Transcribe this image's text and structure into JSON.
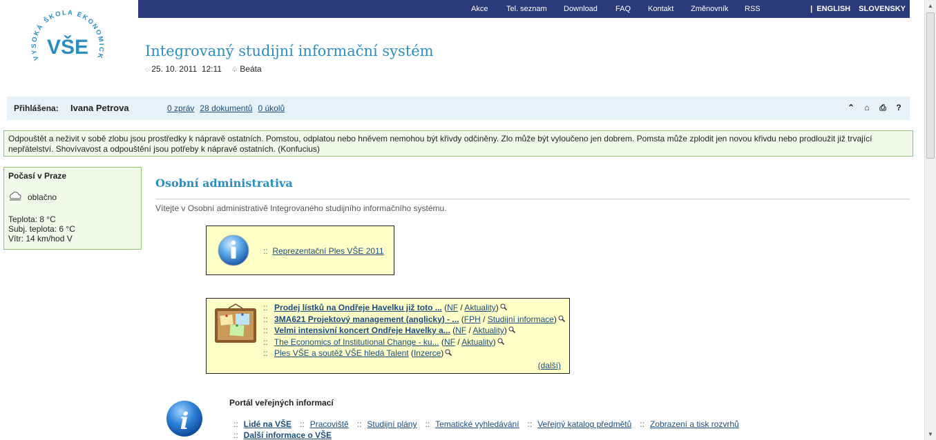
{
  "topnav": {
    "items": [
      "Akce",
      "Tel. seznam",
      "Download",
      "FAQ",
      "Kontakt",
      "Změnovník",
      "RSS"
    ],
    "separator": "|",
    "lang_en": "ENGLISH",
    "lang_sk": "SLOVENSKY"
  },
  "logo": {
    "text": "VŠE",
    "ring": "VYSOKÁ ŠKOLA EKONOMICKÁ V PRAZE"
  },
  "header": {
    "title": "Integrovaný studijní informační systém",
    "date": "25. 10. 2011",
    "time": "12:11",
    "nameday": "Beáta"
  },
  "loginbar": {
    "label": "Přihlášena:",
    "user": "Ivana Petrova",
    "messages_count": "0",
    "messages_label": "zpráv",
    "documents_count": "28",
    "documents_label": "dokumentů",
    "tasks_count": "0",
    "tasks_label": "úkolů"
  },
  "quote": "Odpouštět a neživit v sobě zlobu jsou prostředky k nápravě ostatních. Pomstou, odplatou nebo hněvem nemohou být křivdy odčiněny. Zlo může být vyloučeno jen dobrem. Pomsta může zplodit jen novou křivdu nebo prodloužit již trvající nepřátelství. Shovívavost a odpouštění jsou potřeby k nápravě ostatních. (Konfucius)",
  "weather": {
    "title": "Počasí v Praze",
    "condition": "oblačno",
    "temp": "Teplota: 8 °C",
    "feels": "Subj. teplota: 6 °C",
    "wind": "Vítr: 14 km/hod V"
  },
  "main": {
    "title": "Osobní administrativa",
    "welcome": "Vítejte v Osobní administrativě Integrovaného studijního informačního systému."
  },
  "info_box": {
    "sep": "::",
    "item": "Reprezentační Ples VŠE 2011"
  },
  "news_box": {
    "sep": "::",
    "items": [
      {
        "title": "Prodej lístků na Ondřeje Havelku již toto ...",
        "bold": true,
        "src": "NF",
        "cat": "Aktuality"
      },
      {
        "title": "3MA621 Projektový management (anglicky) - ...",
        "bold": true,
        "src": "FPH",
        "cat": "Studijní informace"
      },
      {
        "title": "Velmi intensivní koncert Ondřeje Havelky a...",
        "bold": true,
        "src": "NF",
        "cat": "Aktuality"
      },
      {
        "title": "The Economics of Institutional Change - ku...",
        "bold": false,
        "src": "NF",
        "cat": "Aktuality"
      },
      {
        "title": "Ples VŠE a soutěž VŠE hledá Talent",
        "bold": false,
        "src": "",
        "cat": "Inzerce"
      }
    ],
    "more": "(další)"
  },
  "portal": {
    "title": "Portál veřejných informací",
    "sep": "::",
    "links": [
      "Lidé na VŠE",
      "Pracoviště",
      "Studijní plány",
      "Tematické vyhledávání",
      "Veřejný katalog předmětů",
      "Zobrazení a tisk rozvrhů"
    ],
    "links2": [
      "Další informace o VŠE"
    ]
  },
  "icons": {
    "tools": [
      "chevron-up-icon",
      "home-icon",
      "print-icon",
      "help-icon"
    ],
    "accent": "#2a8fc0",
    "nav_bg": "#2a3a7a"
  }
}
